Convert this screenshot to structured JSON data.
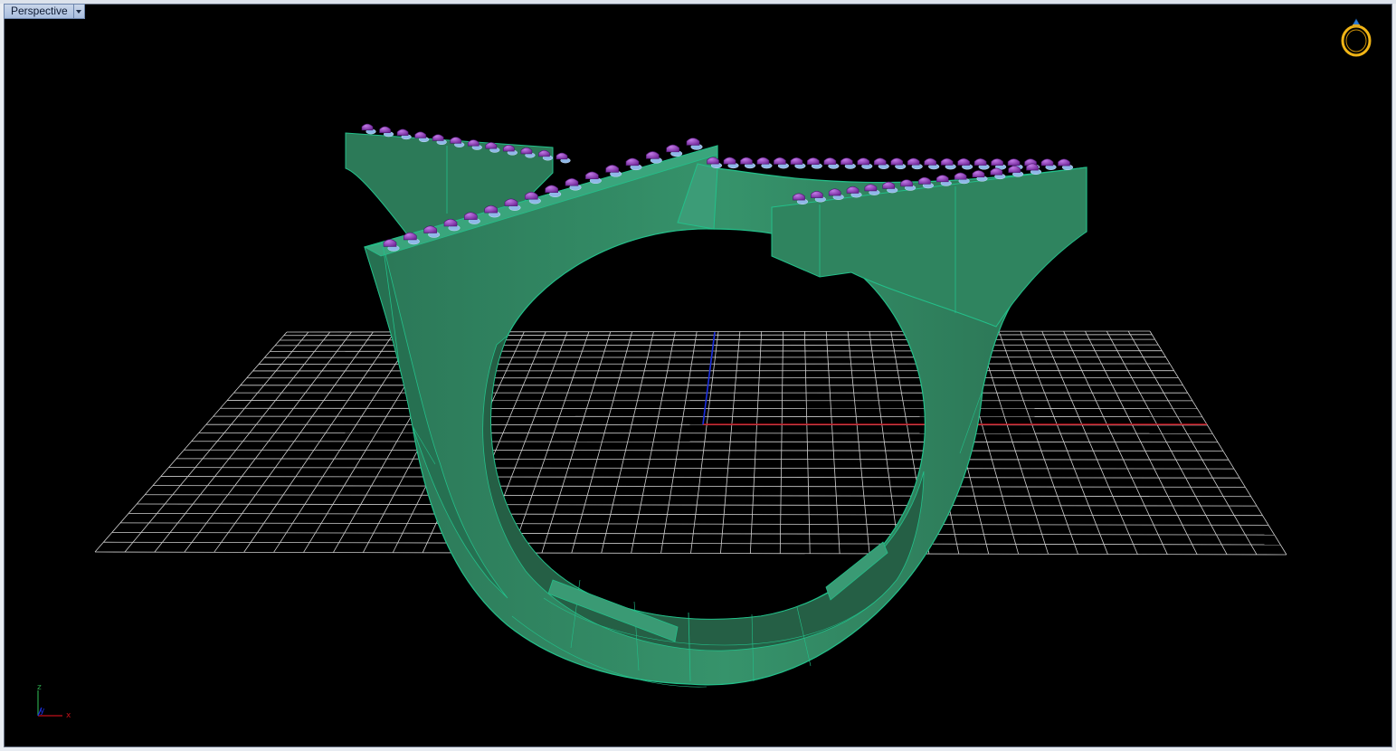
{
  "viewport": {
    "label": "Perspective"
  },
  "axes_widget": {
    "z_label": "z",
    "y_label": "y",
    "x_label": "x"
  },
  "icons": {
    "dropdown": "chevron-down-icon",
    "ring_logo": "ring-icon"
  },
  "colors": {
    "background": "#000000",
    "model": "#2e7d5b",
    "model_edge": "#23c08a",
    "gems": "#8a3fb5",
    "grid": "#d9d9d9",
    "x_axis": "#c0101a",
    "y_axis": "#1b2fe0",
    "logo": "#f1b516"
  }
}
